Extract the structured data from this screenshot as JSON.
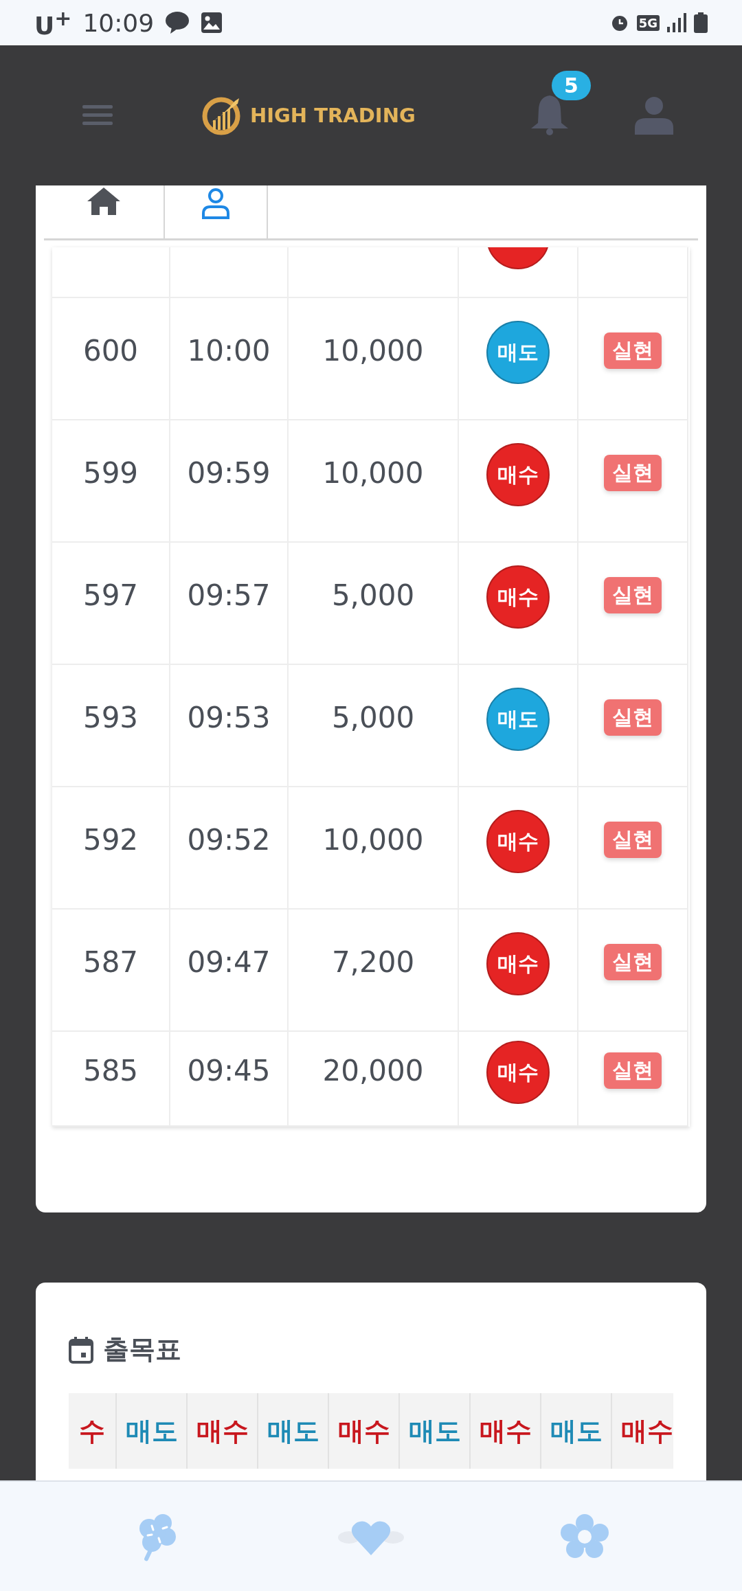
{
  "status_bar": {
    "carrier": "U$^{+}$",
    "time": "10:09",
    "network": "5G"
  },
  "header": {
    "logo_text": "HIGH TRADING",
    "notification_count": "5"
  },
  "tabs": [
    {
      "kind": "home",
      "selected": false
    },
    {
      "kind": "user",
      "selected": true
    }
  ],
  "table": {
    "top_cut_row": {
      "kind": "buy"
    },
    "rows": [
      {
        "number": "600",
        "time": "10:00",
        "amount": "10,000",
        "kind": "sell",
        "side_label": "매도",
        "status": "실현"
      },
      {
        "number": "599",
        "time": "09:59",
        "amount": "10,000",
        "kind": "buy",
        "side_label": "매수",
        "status": "실현"
      },
      {
        "number": "597",
        "time": "09:57",
        "amount": "5,000",
        "kind": "buy",
        "side_label": "매수",
        "status": "실현"
      },
      {
        "number": "593",
        "time": "09:53",
        "amount": "5,000",
        "kind": "sell",
        "side_label": "매도",
        "status": "실현"
      },
      {
        "number": "592",
        "time": "09:52",
        "amount": "10,000",
        "kind": "buy",
        "side_label": "매수",
        "status": "실현"
      },
      {
        "number": "587",
        "time": "09:47",
        "amount": "7,200",
        "kind": "buy",
        "side_label": "매수",
        "status": "실현"
      },
      {
        "number": "585",
        "time": "09:45",
        "amount": "20,000",
        "kind": "buy",
        "side_label": "매수",
        "status": "실현"
      }
    ]
  },
  "attendance": {
    "title": "출목표",
    "cells": [
      {
        "label": "수",
        "kind": "buy"
      },
      {
        "label": "매도",
        "kind": "sell"
      },
      {
        "label": "매수",
        "kind": "buy"
      },
      {
        "label": "매도",
        "kind": "sell"
      },
      {
        "label": "매수",
        "kind": "buy"
      },
      {
        "label": "매도",
        "kind": "sell"
      },
      {
        "label": "매수",
        "kind": "buy"
      },
      {
        "label": "매도",
        "kind": "sell"
      },
      {
        "label": "매수",
        "kind": "buy"
      }
    ]
  },
  "bottom_nav": [
    {
      "kind": "clover"
    },
    {
      "kind": "heart"
    },
    {
      "kind": "flower"
    }
  ]
}
